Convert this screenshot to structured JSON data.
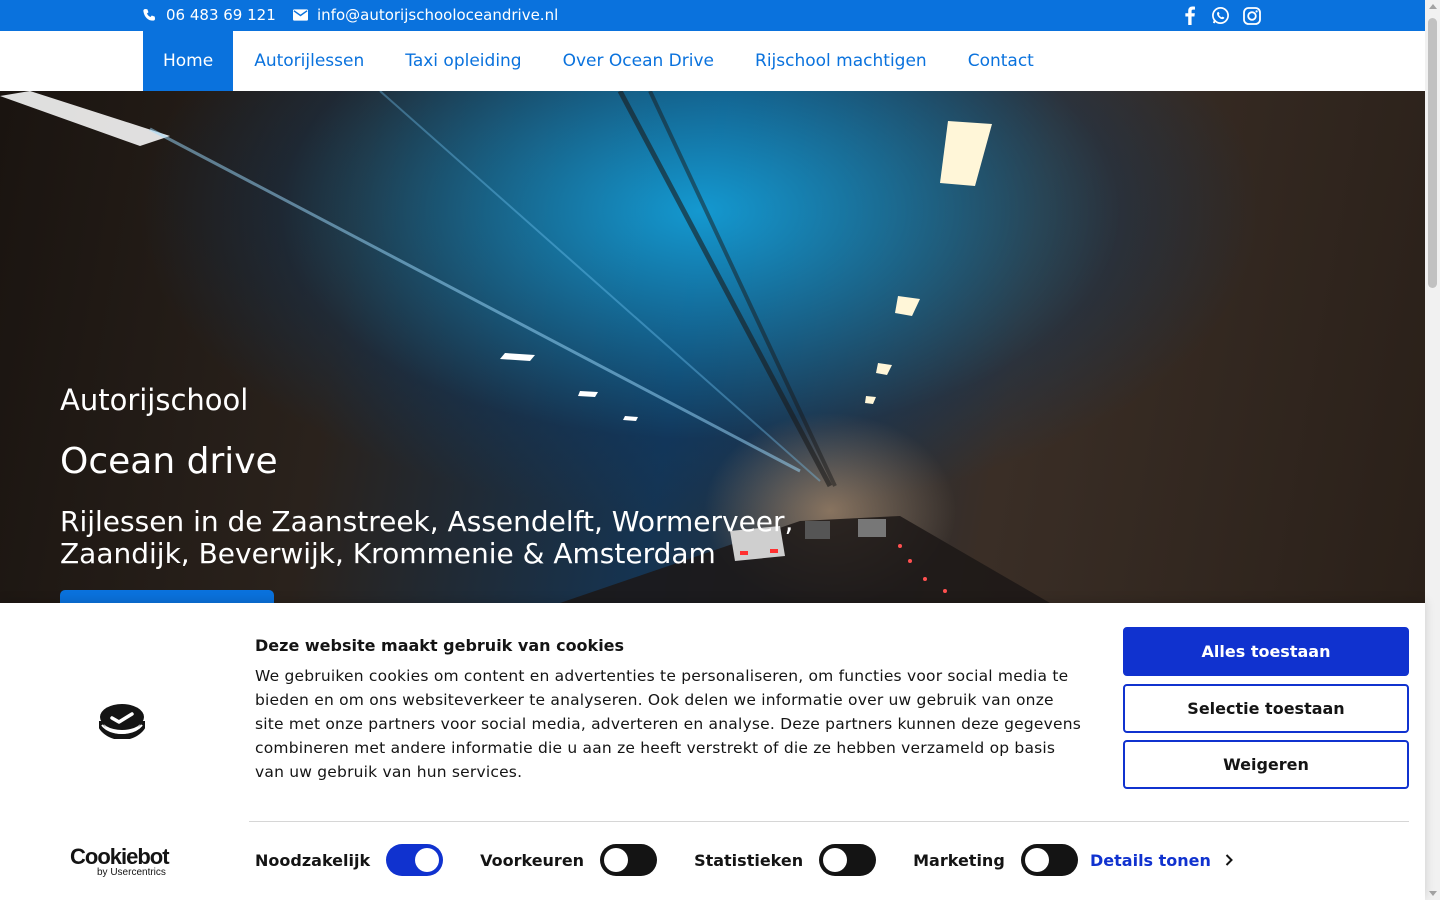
{
  "topbar": {
    "phone": "06 483 69 121",
    "email": "info@autorijschooloceandrive.nl",
    "social_icons": [
      "facebook-icon",
      "whatsapp-icon",
      "instagram-icon"
    ]
  },
  "nav": {
    "items": [
      {
        "label": "Home",
        "active": true
      },
      {
        "label": "Autorijlessen"
      },
      {
        "label": "Taxi opleiding"
      },
      {
        "label": "Over Ocean Drive"
      },
      {
        "label": "Rijschool machtigen"
      },
      {
        "label": "Contact"
      }
    ]
  },
  "hero": {
    "subtitle": "Autorijschool",
    "title": "Ocean drive",
    "tagline": "Rijlessen in de Zaanstreek, Assendelft, Wormerveer, Zaandijk, Beverwijk, Krommenie & Amsterdam"
  },
  "cookie": {
    "title": "Deze website maakt gebruik van cookies",
    "body": "We gebruiken cookies om content en advertenties te personaliseren, om functies voor social media te bieden en om ons websiteverkeer te analyseren. Ook delen we informatie over uw gebruik van onze site met onze partners voor social media, adverteren en analyse. Deze partners kunnen deze gegevens combineren met andere informatie die u aan ze heeft verstrekt of die ze hebben verzameld op basis van uw gebruik van hun services.",
    "buttons": {
      "allow_all": "Alles toestaan",
      "allow_selection": "Selectie toestaan",
      "deny": "Weigeren"
    },
    "toggles": [
      {
        "label": "Noodzakelijk",
        "on": true
      },
      {
        "label": "Voorkeuren",
        "on": false
      },
      {
        "label": "Statistieken",
        "on": false
      },
      {
        "label": "Marketing",
        "on": false
      }
    ],
    "details": "Details tonen",
    "brand": {
      "name": "Cookiebot",
      "by": "by Usercentrics"
    }
  },
  "colors": {
    "primary": "#0a72dd",
    "cookie_accent": "#1032cf"
  }
}
